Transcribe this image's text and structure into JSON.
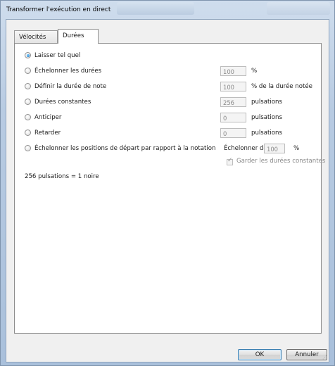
{
  "window": {
    "title": "Transformer l'exécution en direct"
  },
  "tabs": [
    {
      "label": "Vélocités",
      "active": false
    },
    {
      "label": "Durées",
      "active": true
    }
  ],
  "options": [
    {
      "label": "Laisser tel quel",
      "selected": true
    },
    {
      "label": "Échelonner les durées",
      "selected": false,
      "value": "100",
      "unit": "%"
    },
    {
      "label": "Définir la durée de note",
      "selected": false,
      "value": "100",
      "unit": "% de la durée notée"
    },
    {
      "label": "Durées constantes",
      "selected": false,
      "value": "256",
      "unit": "pulsations"
    },
    {
      "label": "Anticiper",
      "selected": false,
      "value": "0",
      "unit": "pulsations"
    },
    {
      "label": "Retarder",
      "selected": false,
      "value": "0",
      "unit": "pulsations"
    },
    {
      "label": "Échelonner les positions de départ par rapport à la notation",
      "selected": false,
      "prefix": "Échelonner de",
      "value": "100",
      "unit": "%"
    }
  ],
  "keep_constant": {
    "label": "Garder les durées constantes",
    "checked": true,
    "enabled": false
  },
  "note": "256 pulsations = 1 noire",
  "buttons": {
    "ok": "OK",
    "cancel": "Annuler"
  },
  "colors": {
    "titlebar": "#b8cbe2",
    "accent_radio": "#1673c8",
    "default_button_border": "#3c7fb1"
  }
}
